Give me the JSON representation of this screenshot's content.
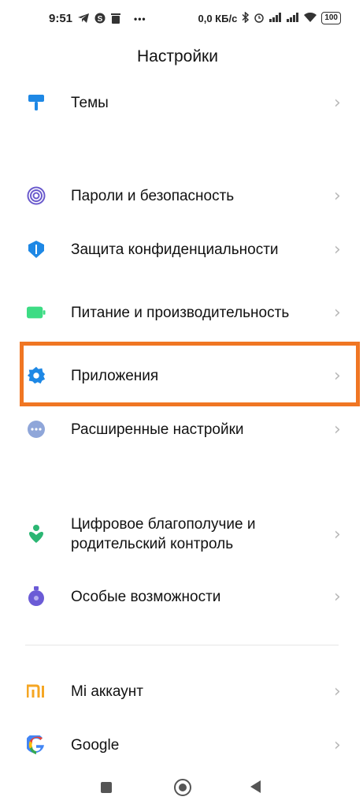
{
  "status_bar": {
    "time": "9:51",
    "left_icons": [
      "telegram-icon",
      "skype-icon",
      "trash-icon"
    ],
    "overflow": "•••",
    "network_speed": "0,0 КБ/с",
    "right_icons": [
      "bluetooth-icon",
      "alarm-icon",
      "signal-icon",
      "signal-icon",
      "wifi-icon"
    ],
    "battery": "100"
  },
  "page_title": "Настройки",
  "settings_items": [
    {
      "label": "Темы",
      "icon": "brush-icon",
      "color": "#1e88e5"
    },
    {
      "label": "Пароли и безопасность",
      "icon": "fingerprint-icon",
      "color": "#6a5acd"
    },
    {
      "label": "Защита конфиденциальности",
      "icon": "shield-icon",
      "color": "#1e88e5"
    },
    {
      "label": "Питание и производительность",
      "icon": "battery-icon",
      "color": "#3ddc84"
    },
    {
      "label": "Приложения",
      "icon": "gear-icon",
      "color": "#1e88e5"
    },
    {
      "label": "Расширенные настройки",
      "icon": "more-dots-icon",
      "color": "#8fa6d9"
    },
    {
      "label": "Цифровое благополучие и родительский контроль",
      "icon": "wellbeing-icon",
      "color": "#2bb673"
    },
    {
      "label": "Особые возможности",
      "icon": "accessibility-icon",
      "color": "#6b5bd6"
    },
    {
      "label": "Mi аккаунт",
      "icon": "mi-icon",
      "color": "#f5a623"
    },
    {
      "label": "Google",
      "icon": "google-icon",
      "color": "#4285f4"
    }
  ],
  "chevron": "›",
  "highlight_color": "#f07623"
}
